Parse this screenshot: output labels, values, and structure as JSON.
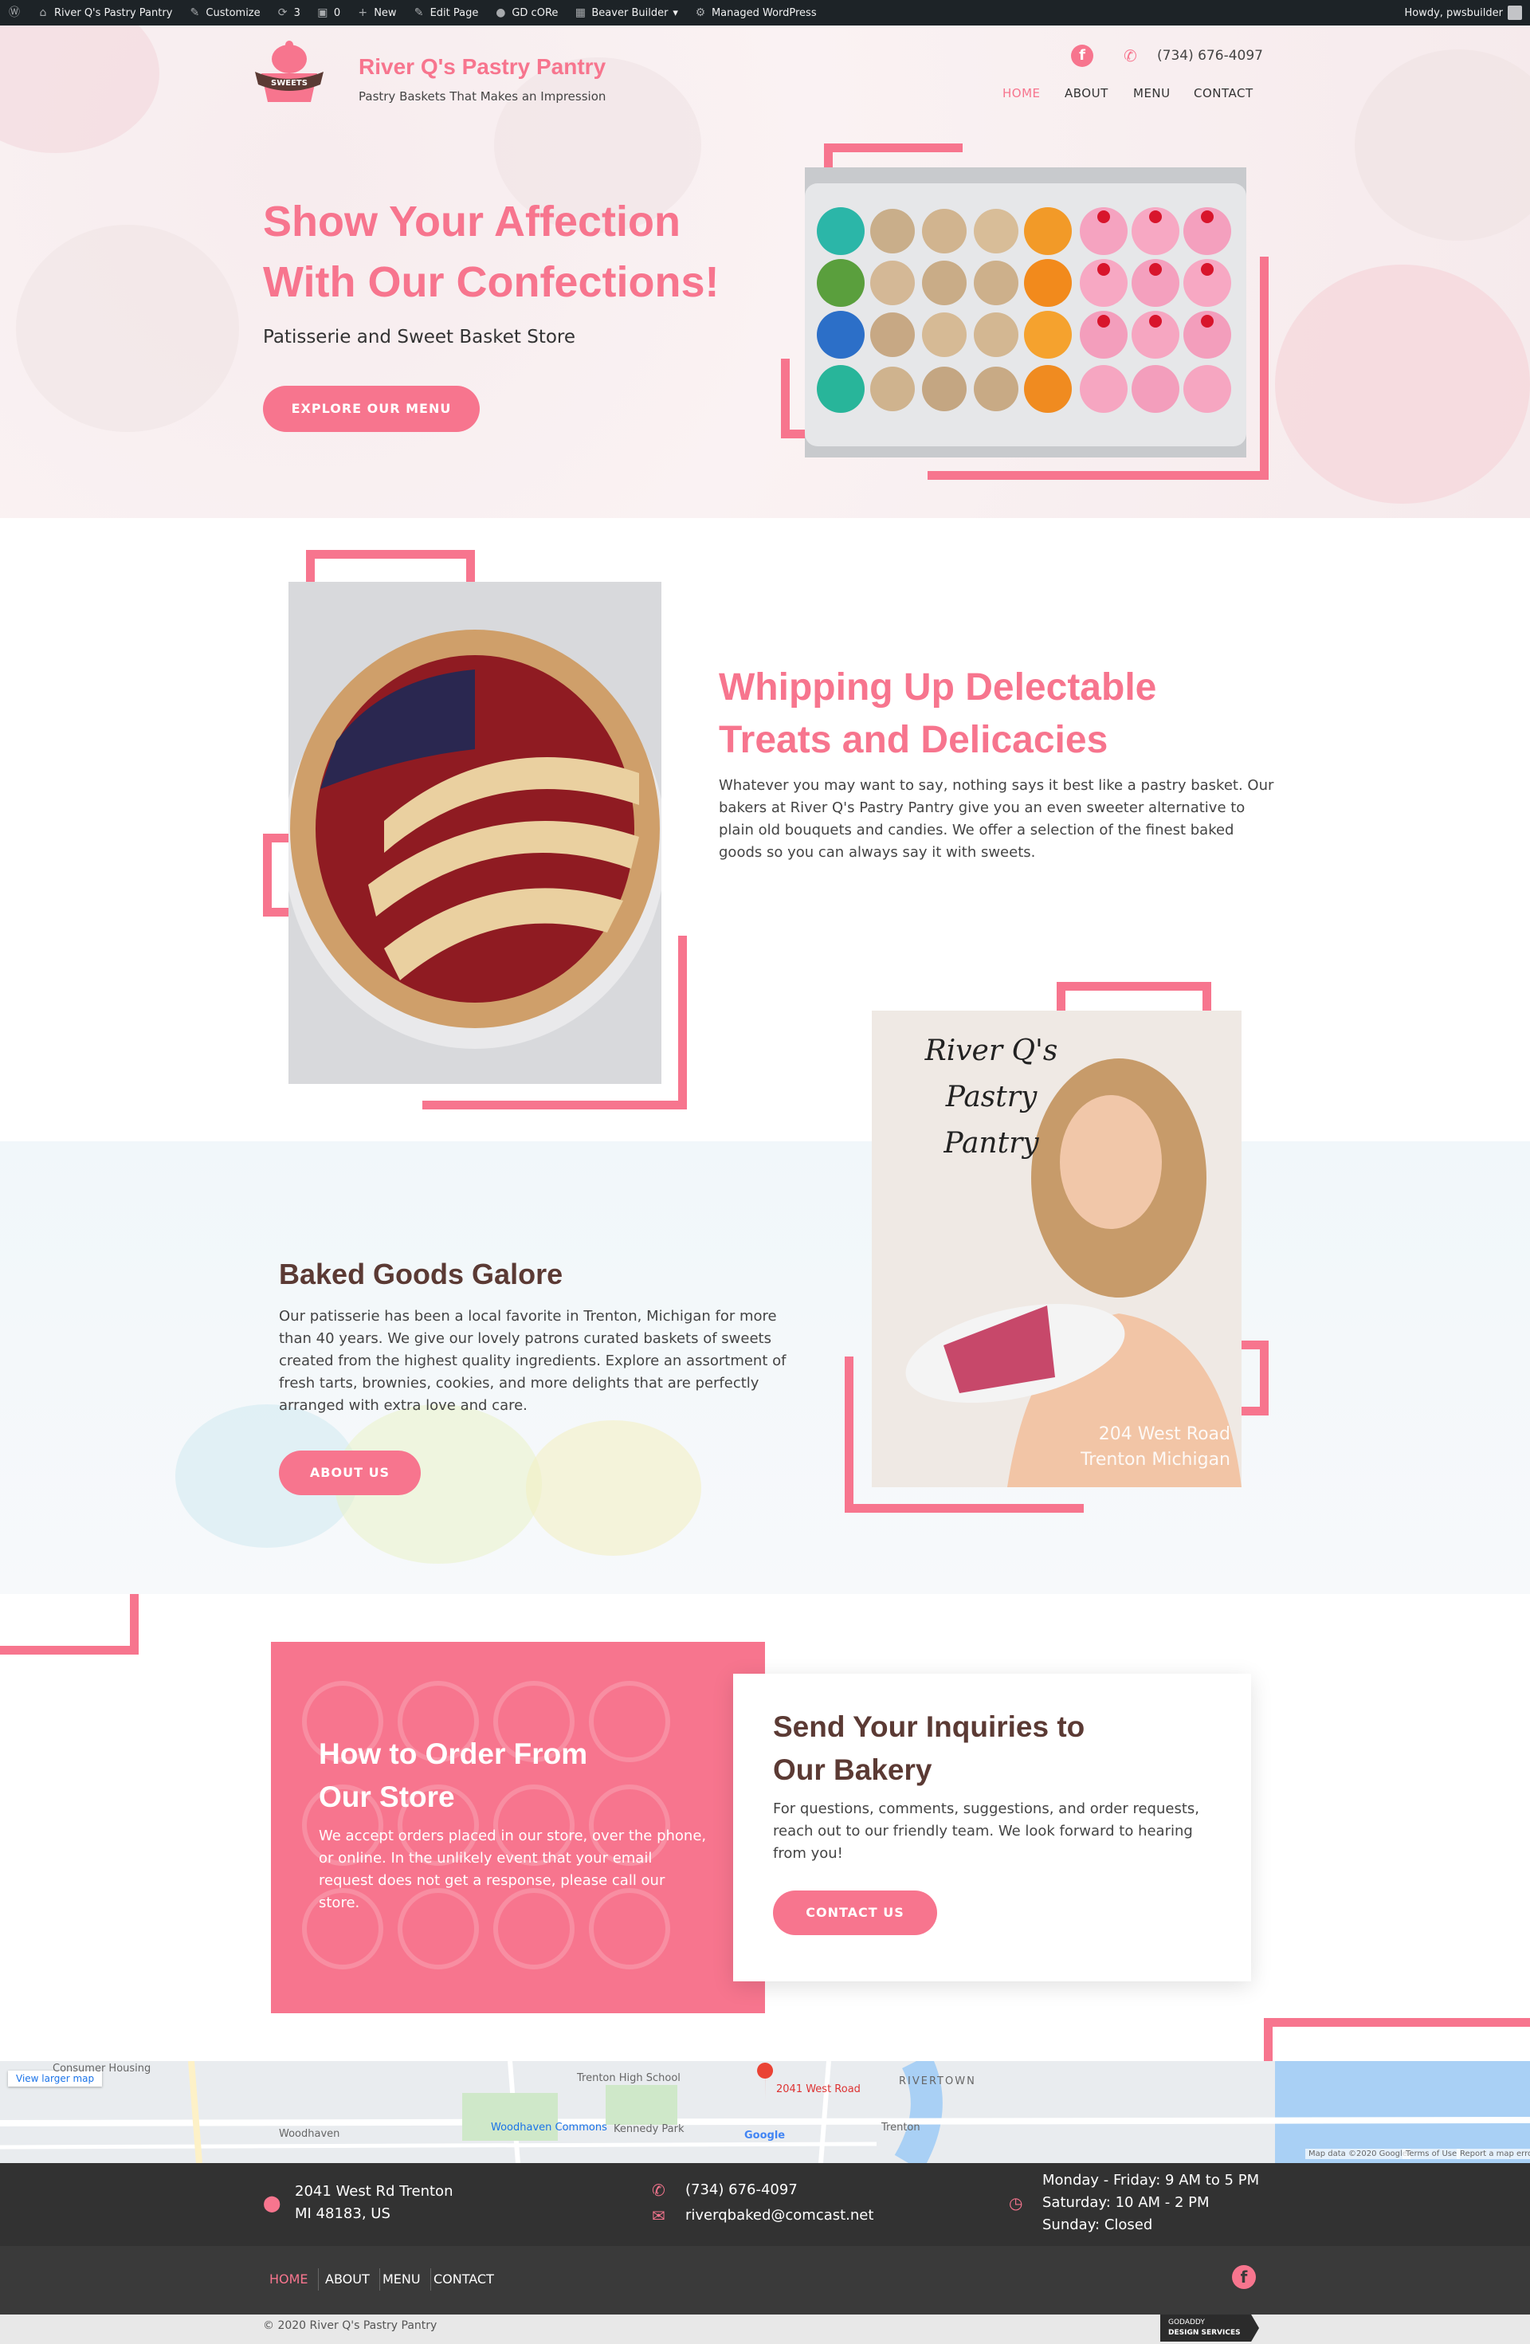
{
  "admin_bar": {
    "items": [
      "River Q's Pastry Pantry",
      "Customize",
      "3",
      "0",
      "New",
      "Edit Page",
      "GD cORe",
      "Beaver Builder",
      "Managed WordPress"
    ],
    "howdy": "Howdy, pwsbuilder"
  },
  "header": {
    "brand_name": "River Q's Pastry Pantry",
    "tagline": "Pastry Baskets That Makes an Impression",
    "logo_text": "SWEETS",
    "phone": "(734) 676-4097",
    "nav": [
      "HOME",
      "ABOUT",
      "MENU",
      "CONTACT"
    ]
  },
  "hero": {
    "title_line1": "Show Your Affection",
    "title_line2": "With Our Confections!",
    "subtitle": "Patisserie and Sweet Basket Store",
    "button": "EXPLORE OUR MENU"
  },
  "section2": {
    "title_line1": "Whipping Up Delectable",
    "title_line2": "Treats and Delicacies",
    "body": "Whatever you may want to say, nothing says it best like a pastry basket. Our bakers at River Q's Pastry Pantry give you an even sweeter alternative to plain old bouquets and candies. We offer a selection of the finest baked goods so you can always say it with sweets."
  },
  "section3": {
    "title": "Baked Goods Galore",
    "body": "Our patisserie has been a local favorite in Trenton, Michigan for more than 40 years. We give our lovely patrons curated baskets of sweets created from the highest quality ingredients. Explore an assortment of fresh tarts, brownies, cookies, and more delights that are perfectly arranged with extra love and care.",
    "button": "ABOUT US",
    "photo_caption_line1": "River Q's Pastry",
    "photo_caption_line2": "Pantry",
    "photo_address_line1": "204 West Road",
    "photo_address_line2": "Trenton Michigan"
  },
  "section4": {
    "order_title_line1": "How to Order From",
    "order_title_line2": "Our Store",
    "order_body": "We accept orders placed in our store, over the phone, or online. In the unlikely event that your email request does not get a response, please call our store.",
    "inquiry_title_line1": "Send Your Inquiries to",
    "inquiry_title_line2": "Our Bakery",
    "inquiry_body": "For questions, comments, suggestions, and order requests, reach out to our friendly team. We look forward to hearing from you!",
    "button": "CONTACT US"
  },
  "map": {
    "view_larger": "View larger map",
    "labels": [
      "Consumer Housing",
      "Trenton High School",
      "2041 West Road",
      "RIVERTOWN",
      "Woodhaven",
      "Woodhaven Commons",
      "Kennedy Park",
      "Trenton",
      "Google"
    ],
    "footer_text": [
      "Map data ©2020 Google",
      "Terms of Use",
      "Report a map error"
    ]
  },
  "footer": {
    "address_line1": "2041 West Rd Trenton",
    "address_line2": "MI 48183, US",
    "phone": "(734) 676-4097",
    "email": "riverqbaked@comcast.net",
    "hours": [
      "Monday - Friday: 9 AM to 5 PM",
      "Saturday: 10 AM - 2 PM",
      "Sunday: Closed"
    ],
    "nav": [
      "HOME",
      "ABOUT",
      "MENU",
      "CONTACT"
    ],
    "copyright": "© 2020 River Q's Pastry Pantry",
    "badge_line1": "GODADDY",
    "badge_line2": "DESIGN SERVICES"
  },
  "colors": {
    "accent": "#f7758e",
    "brown": "#5b3a34",
    "footer": "#323232"
  }
}
